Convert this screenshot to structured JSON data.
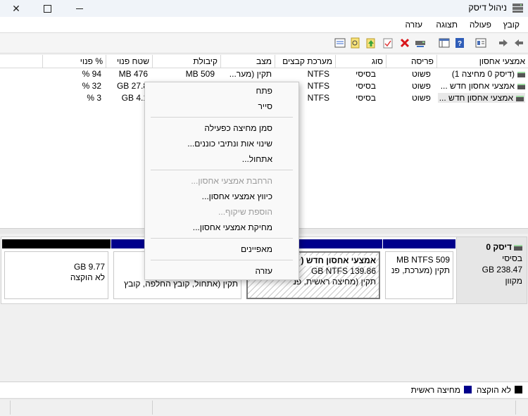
{
  "window": {
    "title": "ניהול דיסק"
  },
  "menu": {
    "items": [
      "קובץ",
      "פעולה",
      "תצוגה",
      "עזרה"
    ]
  },
  "volume_list": {
    "columns": [
      "אמצעי אחסון",
      "פריסה",
      "סוג",
      "מערכת קבצים",
      "מצב",
      "קיבולת",
      "שטח פנוי",
      "% פנוי"
    ],
    "rows": [
      {
        "volume": "(דיסק 0 מחיצה 1)",
        "layout": "פשוט",
        "type": "בסיסי",
        "fs": "NTFS",
        "status": "תקין (מער...",
        "capacity": "MB 509",
        "free": "MB 476",
        "pct": "% 94"
      },
      {
        "volume": "אמצעי אחסון חדש ...",
        "layout": "פשוט",
        "type": "בסיסי",
        "fs": "NTFS",
        "status": "",
        "capacity": "",
        "free": "GB 27.8",
        "pct": "% 32"
      },
      {
        "volume": "אמצעי אחסון חדש ...",
        "layout": "פשוט",
        "type": "בסיסי",
        "fs": "NTFS",
        "status": "",
        "capacity": "",
        "free": "GB 4.1",
        "pct": "% 3"
      }
    ]
  },
  "disk0": {
    "name": "דיסק 0",
    "type": "בסיסי",
    "size": "GB 238.47",
    "state": "מקוון",
    "partitions": [
      {
        "title": "",
        "line1": "MB NTFS 509",
        "line2": "תקין (מערכת, פנ",
        "color": "#00008b"
      },
      {
        "title": "אמצעי אחסון חדש (",
        "line1": "GB NTFS 139.86",
        "line2": "תקין (מחיצה ראשית, פנ",
        "color": "#00008b"
      },
      {
        "title": "",
        "line1": "",
        "line2": "תקין (אתחול, קובץ החלפה, קובץ",
        "color": "#00008b"
      },
      {
        "title": "",
        "line1": "GB 9.77",
        "line2": "לא הוקצה",
        "color": "#000000"
      }
    ]
  },
  "legend": [
    {
      "label": "לא הוקצה",
      "color": "#000000"
    },
    {
      "label": "מחיצה ראשית",
      "color": "#00008b"
    }
  ],
  "context_menu": {
    "groups": [
      [
        {
          "label": "פתח",
          "enabled": true
        },
        {
          "label": "סייר",
          "enabled": true
        }
      ],
      [
        {
          "label": "סמן מחיצה כפעילה",
          "enabled": true
        },
        {
          "label": "שינוי אות ונתיבי כוננים...",
          "enabled": true
        },
        {
          "label": "אתחול...",
          "enabled": true
        }
      ],
      [
        {
          "label": "הרחבת אמצעי אחסון...",
          "enabled": false
        },
        {
          "label": "כיווץ אמצעי אחסון...",
          "enabled": true
        },
        {
          "label": "הוספת שיקוף...",
          "enabled": false
        },
        {
          "label": "מחיקת אמצעי אחסון...",
          "enabled": true
        }
      ],
      [
        {
          "label": "מאפיינים",
          "enabled": true
        }
      ],
      [
        {
          "label": "עזרה",
          "enabled": true
        }
      ]
    ]
  },
  "icons": {
    "toolbar": [
      "back-arrow-icon",
      "forward-arrow-icon",
      "console-tree-icon",
      "properties-icon",
      "help-icon",
      "up-folder-icon",
      "connect-drive-icon",
      "delete-icon",
      "check-icon",
      "new-folder-icon",
      "search-drive-icon",
      "list-view-icon"
    ]
  }
}
